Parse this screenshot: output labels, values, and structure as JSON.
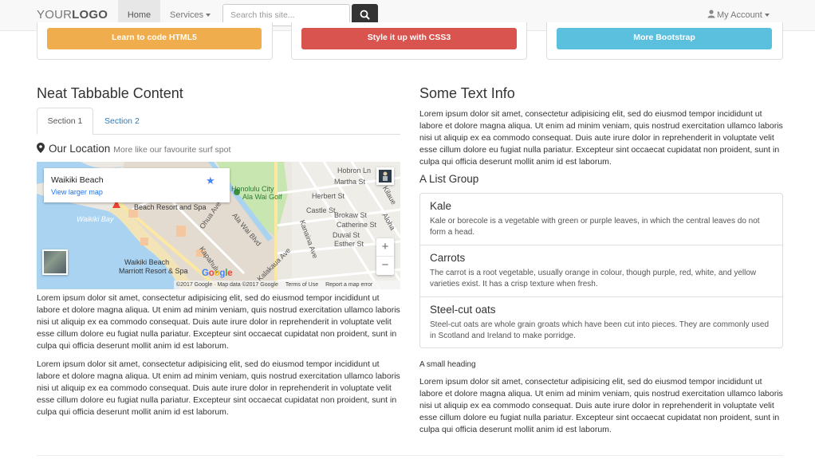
{
  "navbar": {
    "brand_light": "YOUR",
    "brand_bold": "LOGO",
    "home": "Home",
    "services": "Services",
    "search_placeholder": "Search this site...",
    "account": "My Account"
  },
  "cta": {
    "html": "Learn to code HTML5",
    "css": "Style it up with CSS3",
    "bootstrap": "More Bootstrap"
  },
  "colors": {
    "html": "#f0ad4e",
    "css": "#d9534f",
    "bootstrap": "#5bc0de",
    "link": "#337ab7"
  },
  "left": {
    "heading": "Neat Tabbable Content",
    "tabs": [
      "Section 1",
      "Section 2"
    ],
    "location_title": "Our Location",
    "location_sub": "More like our favourite surf spot",
    "para1": "Lorem ipsum dolor sit amet, consectetur adipisicing elit, sed do eiusmod tempor incididunt ut labore et dolore magna aliqua. Ut enim ad minim veniam, quis nostrud exercitation ullamco laboris nisi ut aliquip ex ea commodo consequat. Duis aute irure dolor in reprehenderit in voluptate velit esse cillum dolore eu fugiat nulla pariatur. Excepteur sint occaecat cupidatat non proident, sunt in culpa qui officia deserunt mollit anim id est laborum.",
    "para2": "Lorem ipsum dolor sit amet, consectetur adipisicing elit, sed do eiusmod tempor incididunt ut labore et dolore magna aliqua. Ut enim ad minim veniam, quis nostrud exercitation ullamco laboris nisi ut aliquip ex ea commodo consequat. Duis aute irure dolor in reprehenderit in voluptate velit esse cillum dolore eu fugiat nulla pariatur. Excepteur sint occaecat cupidatat non proident, sunt in culpa qui officia deserunt mollit anim id est laborum."
  },
  "map": {
    "place": "Waikiki Beach",
    "view_larger": "View larger map",
    "zoom_in": "+",
    "zoom_out": "−",
    "google": "Google",
    "attribution": "©2017 Google · Map data ©2017 Google",
    "terms": "Terms of Use",
    "report": "Report a map error",
    "labels": {
      "city": "Honolulu City",
      "park": "Ala Wai Golf",
      "resort": "Beach Resort and Spa",
      "bay": "Waikiki Bay",
      "marriott1": "Waikiki Beach",
      "marriott2": "Marriott Resort & Spa",
      "hobron": "Hobron Ln",
      "martha": "Martha St",
      "herbert": "Herbert St",
      "castle": "Castle St",
      "brokaw": "Brokaw St",
      "catherine": "Catherine St",
      "duval": "Duval St",
      "esther": "Esther St",
      "ohua": "Ohua Ave",
      "alawai": "Ala Wai Blvd",
      "kapahulu": "Kapahulu",
      "kanaina": "Kanaina Ave",
      "kalakaua": "Kalakaua Ave",
      "kilauea": "Kilaue",
      "alohea": "Aloha"
    }
  },
  "right": {
    "heading": "Some Text Info",
    "intro": "Lorem ipsum dolor sit amet, consectetur adipisicing elit, sed do eiusmod tempor incididunt ut labore et dolore magna aliqua. Ut enim ad minim veniam, quis nostrud exercitation ullamco laboris nisi ut aliquip ex ea commodo consequat. Duis aute irure dolor in reprehenderit in voluptate velit esse cillum dolore eu fugiat nulla pariatur. Excepteur sint occaecat cupidatat non proident, sunt in culpa qui officia deserunt mollit anim id est laborum.",
    "list_heading": "A List Group",
    "items": [
      {
        "title": "Kale",
        "text": "Kale or borecole is a vegetable with green or purple leaves, in which the central leaves do not form a head."
      },
      {
        "title": "Carrots",
        "text": "The carrot is a root vegetable, usually orange in colour, though purple, red, white, and yellow varieties exist. It has a crisp texture when fresh."
      },
      {
        "title": "Steel-cut oats",
        "text": "Steel-cut oats are whole grain groats which have been cut into pieces. They are commonly used in Scotland and Ireland to make porridge."
      }
    ],
    "small_heading": "A small heading",
    "outro": "Lorem ipsum dolor sit amet, consectetur adipisicing elit, sed do eiusmod tempor incididunt ut labore et dolore magna aliqua. Ut enim ad minim veniam, quis nostrud exercitation ullamco laboris nisi ut aliquip ex ea commodo consequat. Duis aute irure dolor in reprehenderit in voluptate velit esse cillum dolore eu fugiat nulla pariatur. Excepteur sint occaecat cupidatat non proident, sunt in culpa qui officia deserunt mollit anim id est laborum."
  }
}
